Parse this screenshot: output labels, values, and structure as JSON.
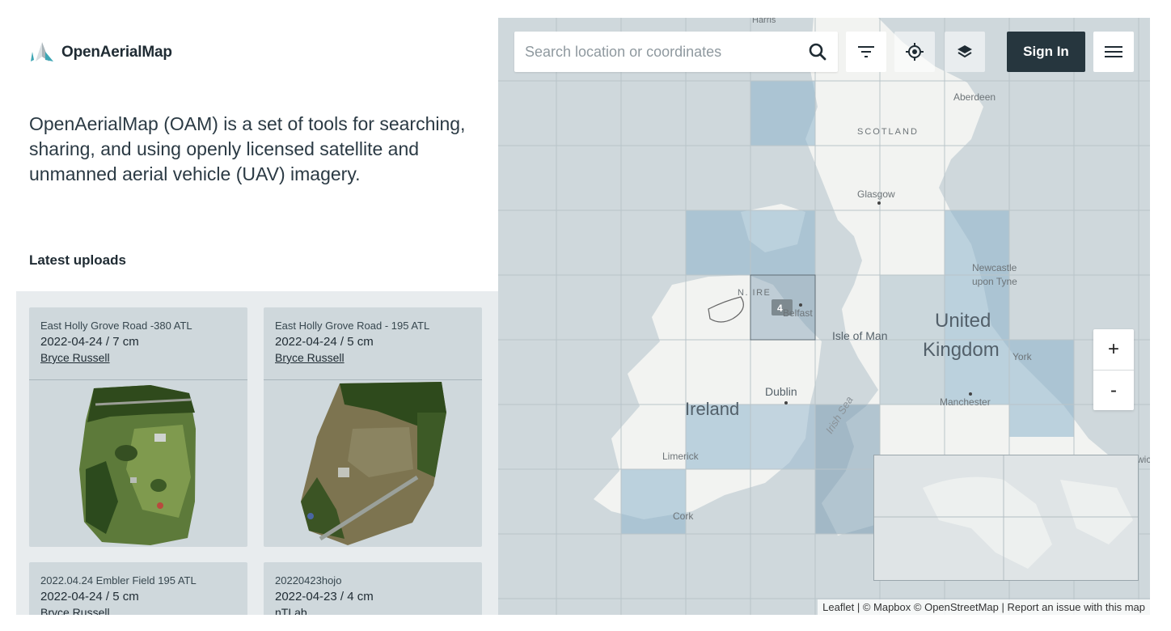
{
  "brand": {
    "name": "OpenAerialMap",
    "accent": "#3ea6b4"
  },
  "intro": "OpenAerialMap (OAM) is a set of tools for searching, sharing, and using openly licensed satellite and unmanned aerial vehicle (UAV) imagery.",
  "latest_heading": "Latest uploads",
  "uploads": [
    {
      "title": "East Holly Grove Road -380 ATL",
      "date_res": "2022-04-24 / 7 cm",
      "user": "Bryce Russell"
    },
    {
      "title": "East Holly Grove Road - 195 ATL",
      "date_res": "2022-04-24 / 5 cm",
      "user": "Bryce Russell"
    },
    {
      "title": "2022.04.24 Embler Field 195 ATL",
      "date_res": "2022-04-24 / 5 cm",
      "user": "Bryce Russell"
    },
    {
      "title": "20220423hojo",
      "date_res": "2022-04-23 / 4 cm",
      "user": "nTLab"
    }
  ],
  "search": {
    "placeholder": "Search location or coordinates",
    "icon": "search-icon"
  },
  "toolbar": {
    "filter_icon": "filter-icon",
    "locate_icon": "crosshair-icon",
    "layers_icon": "layers-icon",
    "sign_in": "Sign In",
    "menu_icon": "hamburger-menu-icon"
  },
  "zoom": {
    "in": "+",
    "out": "-"
  },
  "map": {
    "labels": {
      "aberdeen": "Aberdeen",
      "scotland": "SCOTLAND",
      "glasgow": "Glasgow",
      "newcastle1": "Newcastle",
      "newcastle2": "upon Tyne",
      "united": "United",
      "kingdom": "Kingdom",
      "york": "York",
      "isle_of_man": "Isle of Man",
      "manchester": "Manchester",
      "ireland": "Ireland",
      "dublin": "Dublin",
      "irish_sea": "Irish Sea",
      "n_ire": "N. IRE",
      "belfast": "Belfast",
      "limerick": "Limerick",
      "cork": "Cork",
      "top_partial": "Harris",
      "right_partial": "wic"
    },
    "cluster_count": "4"
  },
  "attribution": {
    "leaflet": "Leaflet",
    "sep1": " | © ",
    "mapbox": "Mapbox",
    "sep2": " © ",
    "osm": "OpenStreetMap",
    "sep3": " | ",
    "report": "Report an issue with this map"
  }
}
